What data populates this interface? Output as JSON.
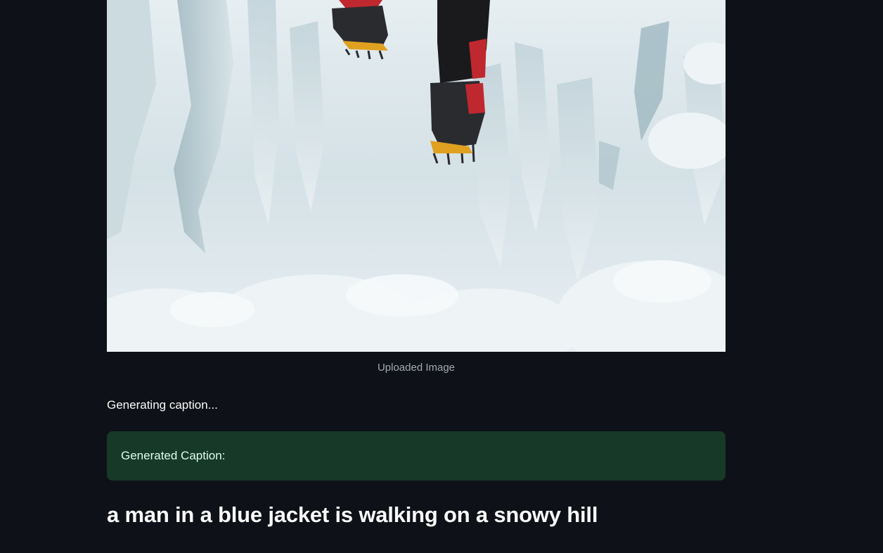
{
  "image": {
    "alt": "Uploaded Image",
    "caption": "Uploaded Image"
  },
  "status": {
    "text": "Generating caption..."
  },
  "success": {
    "label": "Generated Caption:"
  },
  "result": {
    "caption": "a man in a blue jacket is walking on a snowy hill"
  },
  "colors": {
    "background": "#0e1117",
    "success_bg": "#173928",
    "success_text": "#dffde9",
    "caption_text": "#a3a8b4"
  }
}
